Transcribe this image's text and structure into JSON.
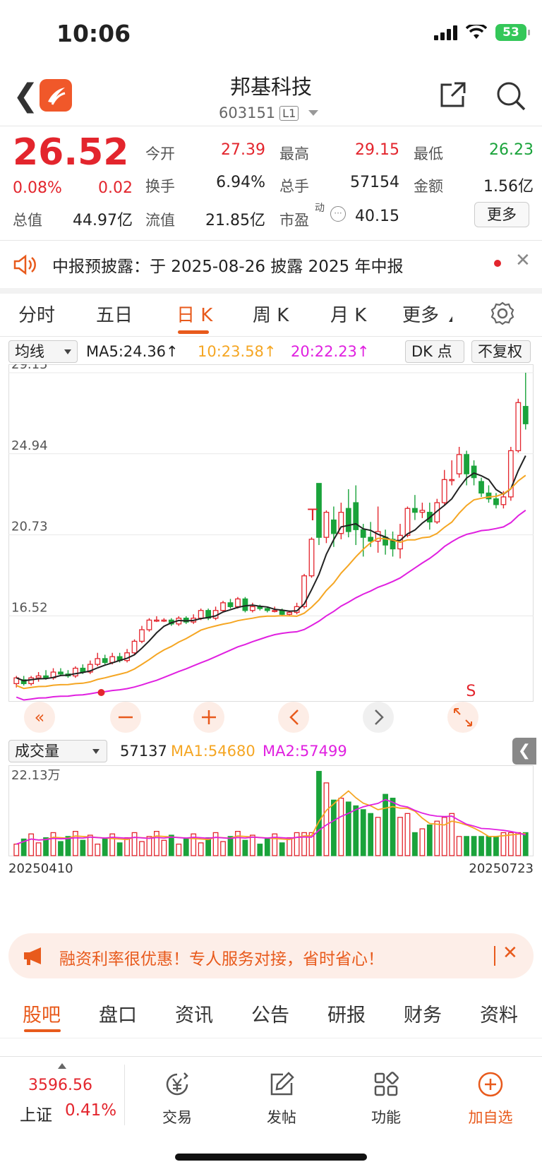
{
  "status": {
    "time": "10:06",
    "battery": "53"
  },
  "header": {
    "title": "邦基科技",
    "code": "603151",
    "level": "L1"
  },
  "quote": {
    "price": "26.52",
    "change_pct": "0.08%",
    "change": "0.02",
    "fields": [
      {
        "label": "今开",
        "value": "27.39"
      },
      {
        "label": "最高",
        "value": "29.15"
      },
      {
        "label": "最低",
        "value": "26.23"
      },
      {
        "label": "换手",
        "value": "6.94%"
      },
      {
        "label": "总手",
        "value": "57154"
      },
      {
        "label": "金额",
        "value": "1.56亿"
      },
      {
        "label": "总值",
        "value": "44.97亿"
      },
      {
        "label": "流值",
        "value": "21.85亿"
      },
      {
        "label": "市盈",
        "value": "40.15"
      }
    ],
    "pe_suffix": "动",
    "more": "更多"
  },
  "notice": {
    "text": "中报预披露：于 2025-08-26 披露 2025 年中报"
  },
  "tabs": [
    "分时",
    "五日",
    "日 K",
    "周 K",
    "月 K",
    "更多"
  ],
  "ma_bar": {
    "select": "均线",
    "ma5": "MA5:24.36↑",
    "ma10": "10:23.58↑",
    "ma20": "20:22.23↑",
    "dk": "DK 点",
    "adjust": "不复权"
  },
  "chart_data": {
    "type": "candlestick",
    "y_ticks": [
      "29.15",
      "24.94",
      "20.73",
      "16.52"
    ],
    "ylim": [
      12.5,
      29.15
    ],
    "x_start": "20250410",
    "x_end": "20250723",
    "marks": [
      "T",
      "S"
    ],
    "candles": [
      [
        13.0,
        13.3,
        12.8,
        13.4
      ],
      [
        13.2,
        13.0,
        12.9,
        13.4
      ],
      [
        13.0,
        13.3,
        12.9,
        13.4
      ],
      [
        13.3,
        13.4,
        13.1,
        13.6
      ],
      [
        13.4,
        13.3,
        13.2,
        13.7
      ],
      [
        13.3,
        13.6,
        13.2,
        13.8
      ],
      [
        13.6,
        13.5,
        13.4,
        13.8
      ],
      [
        13.5,
        13.4,
        13.3,
        13.7
      ],
      [
        13.4,
        13.8,
        13.3,
        13.9
      ],
      [
        13.8,
        13.6,
        13.5,
        14.0
      ],
      [
        13.6,
        14.0,
        13.5,
        14.2
      ],
      [
        14.0,
        14.3,
        13.9,
        14.6
      ],
      [
        14.3,
        14.1,
        14.0,
        14.5
      ],
      [
        14.1,
        14.4,
        14.0,
        14.6
      ],
      [
        14.4,
        14.2,
        14.1,
        14.6
      ],
      [
        14.2,
        14.6,
        14.1,
        14.8
      ],
      [
        14.6,
        15.2,
        14.5,
        15.3
      ],
      [
        15.2,
        15.8,
        15.1,
        16.0
      ],
      [
        15.8,
        16.3,
        15.7,
        16.4
      ],
      [
        16.3,
        16.3,
        16.2,
        16.5
      ],
      [
        16.3,
        16.3,
        16.2,
        16.4
      ],
      [
        16.3,
        16.1,
        16.0,
        16.4
      ],
      [
        16.1,
        16.4,
        16.0,
        16.5
      ],
      [
        16.4,
        16.2,
        16.1,
        16.5
      ],
      [
        16.2,
        16.4,
        16.1,
        16.6
      ],
      [
        16.4,
        16.8,
        16.3,
        16.9
      ],
      [
        16.8,
        16.4,
        16.3,
        16.9
      ],
      [
        16.4,
        16.8,
        16.3,
        17.0
      ],
      [
        16.8,
        17.2,
        16.7,
        17.3
      ],
      [
        17.2,
        17.0,
        16.9,
        17.4
      ],
      [
        17.0,
        17.4,
        16.9,
        17.5
      ],
      [
        17.4,
        16.8,
        16.7,
        17.5
      ],
      [
        16.8,
        17.0,
        16.7,
        17.2
      ],
      [
        17.0,
        16.9,
        16.8,
        17.1
      ],
      [
        16.9,
        16.8,
        16.7,
        17.0
      ],
      [
        16.8,
        16.8,
        16.7,
        17.0
      ],
      [
        16.8,
        16.6,
        16.5,
        16.9
      ],
      [
        16.6,
        16.7,
        16.5,
        16.8
      ],
      [
        16.7,
        17.0,
        16.6,
        17.2
      ],
      [
        17.0,
        18.6,
        16.9,
        18.7
      ],
      [
        18.6,
        20.5,
        18.5,
        20.6
      ],
      [
        23.4,
        20.6,
        20.2,
        23.4
      ],
      [
        20.6,
        21.9,
        20.3,
        22.0
      ],
      [
        21.5,
        20.8,
        20.1,
        22.2
      ],
      [
        20.8,
        21.9,
        20.5,
        22.4
      ],
      [
        22.1,
        20.9,
        20.6,
        23.1
      ],
      [
        22.4,
        21.0,
        20.2,
        23.3
      ],
      [
        21.0,
        20.6,
        19.6,
        21.3
      ],
      [
        20.6,
        20.4,
        20.1,
        21.4
      ],
      [
        20.4,
        20.9,
        19.8,
        22.2
      ],
      [
        20.6,
        20.2,
        19.7,
        21.0
      ],
      [
        20.5,
        20.0,
        19.6,
        20.9
      ],
      [
        20.0,
        20.7,
        19.5,
        21.3
      ],
      [
        20.7,
        22.1,
        20.6,
        22.2
      ],
      [
        22.1,
        21.9,
        21.5,
        22.8
      ],
      [
        21.9,
        22.0,
        21.6,
        22.4
      ],
      [
        21.9,
        21.4,
        21.0,
        22.4
      ],
      [
        21.4,
        22.4,
        21.3,
        22.6
      ],
      [
        22.4,
        23.6,
        22.3,
        24.1
      ],
      [
        23.6,
        23.6,
        23.3,
        24.6
      ],
      [
        23.9,
        24.9,
        23.7,
        25.3
      ],
      [
        24.9,
        23.9,
        23.3,
        25.1
      ],
      [
        24.3,
        23.7,
        23.3,
        24.6
      ],
      [
        23.5,
        22.9,
        22.7,
        23.7
      ],
      [
        22.9,
        22.6,
        22.4,
        23.3
      ],
      [
        22.6,
        22.3,
        22.1,
        22.9
      ],
      [
        22.3,
        22.7,
        22.1,
        23.0
      ],
      [
        22.7,
        25.1,
        22.5,
        25.3
      ],
      [
        25.1,
        27.6,
        25.0,
        27.8
      ],
      [
        27.4,
        26.5,
        26.2,
        29.15
      ]
    ],
    "volume": {
      "label": "成交量",
      "value": "57137",
      "ma1": "MA1:54680",
      "ma2": "MA2:57499",
      "ymax_label": "22.13万"
    }
  },
  "promo": {
    "text": "融资利率很优惠！专人服务对接，省时省心！"
  },
  "bottom_tabs": [
    "股吧",
    "盘口",
    "资讯",
    "公告",
    "研报",
    "财务",
    "资料"
  ],
  "bottom_bar": {
    "index_value": "3596.56",
    "index_name": "上证",
    "index_pct": "0.41%",
    "items": [
      "交易",
      "发帖",
      "功能",
      "加自选"
    ]
  },
  "colors": {
    "up": "#e3252d",
    "down": "#1aa33b",
    "accent": "#e85a1c",
    "ma5": "#222222",
    "ma10": "#f5a623",
    "ma20": "#e020e0"
  }
}
